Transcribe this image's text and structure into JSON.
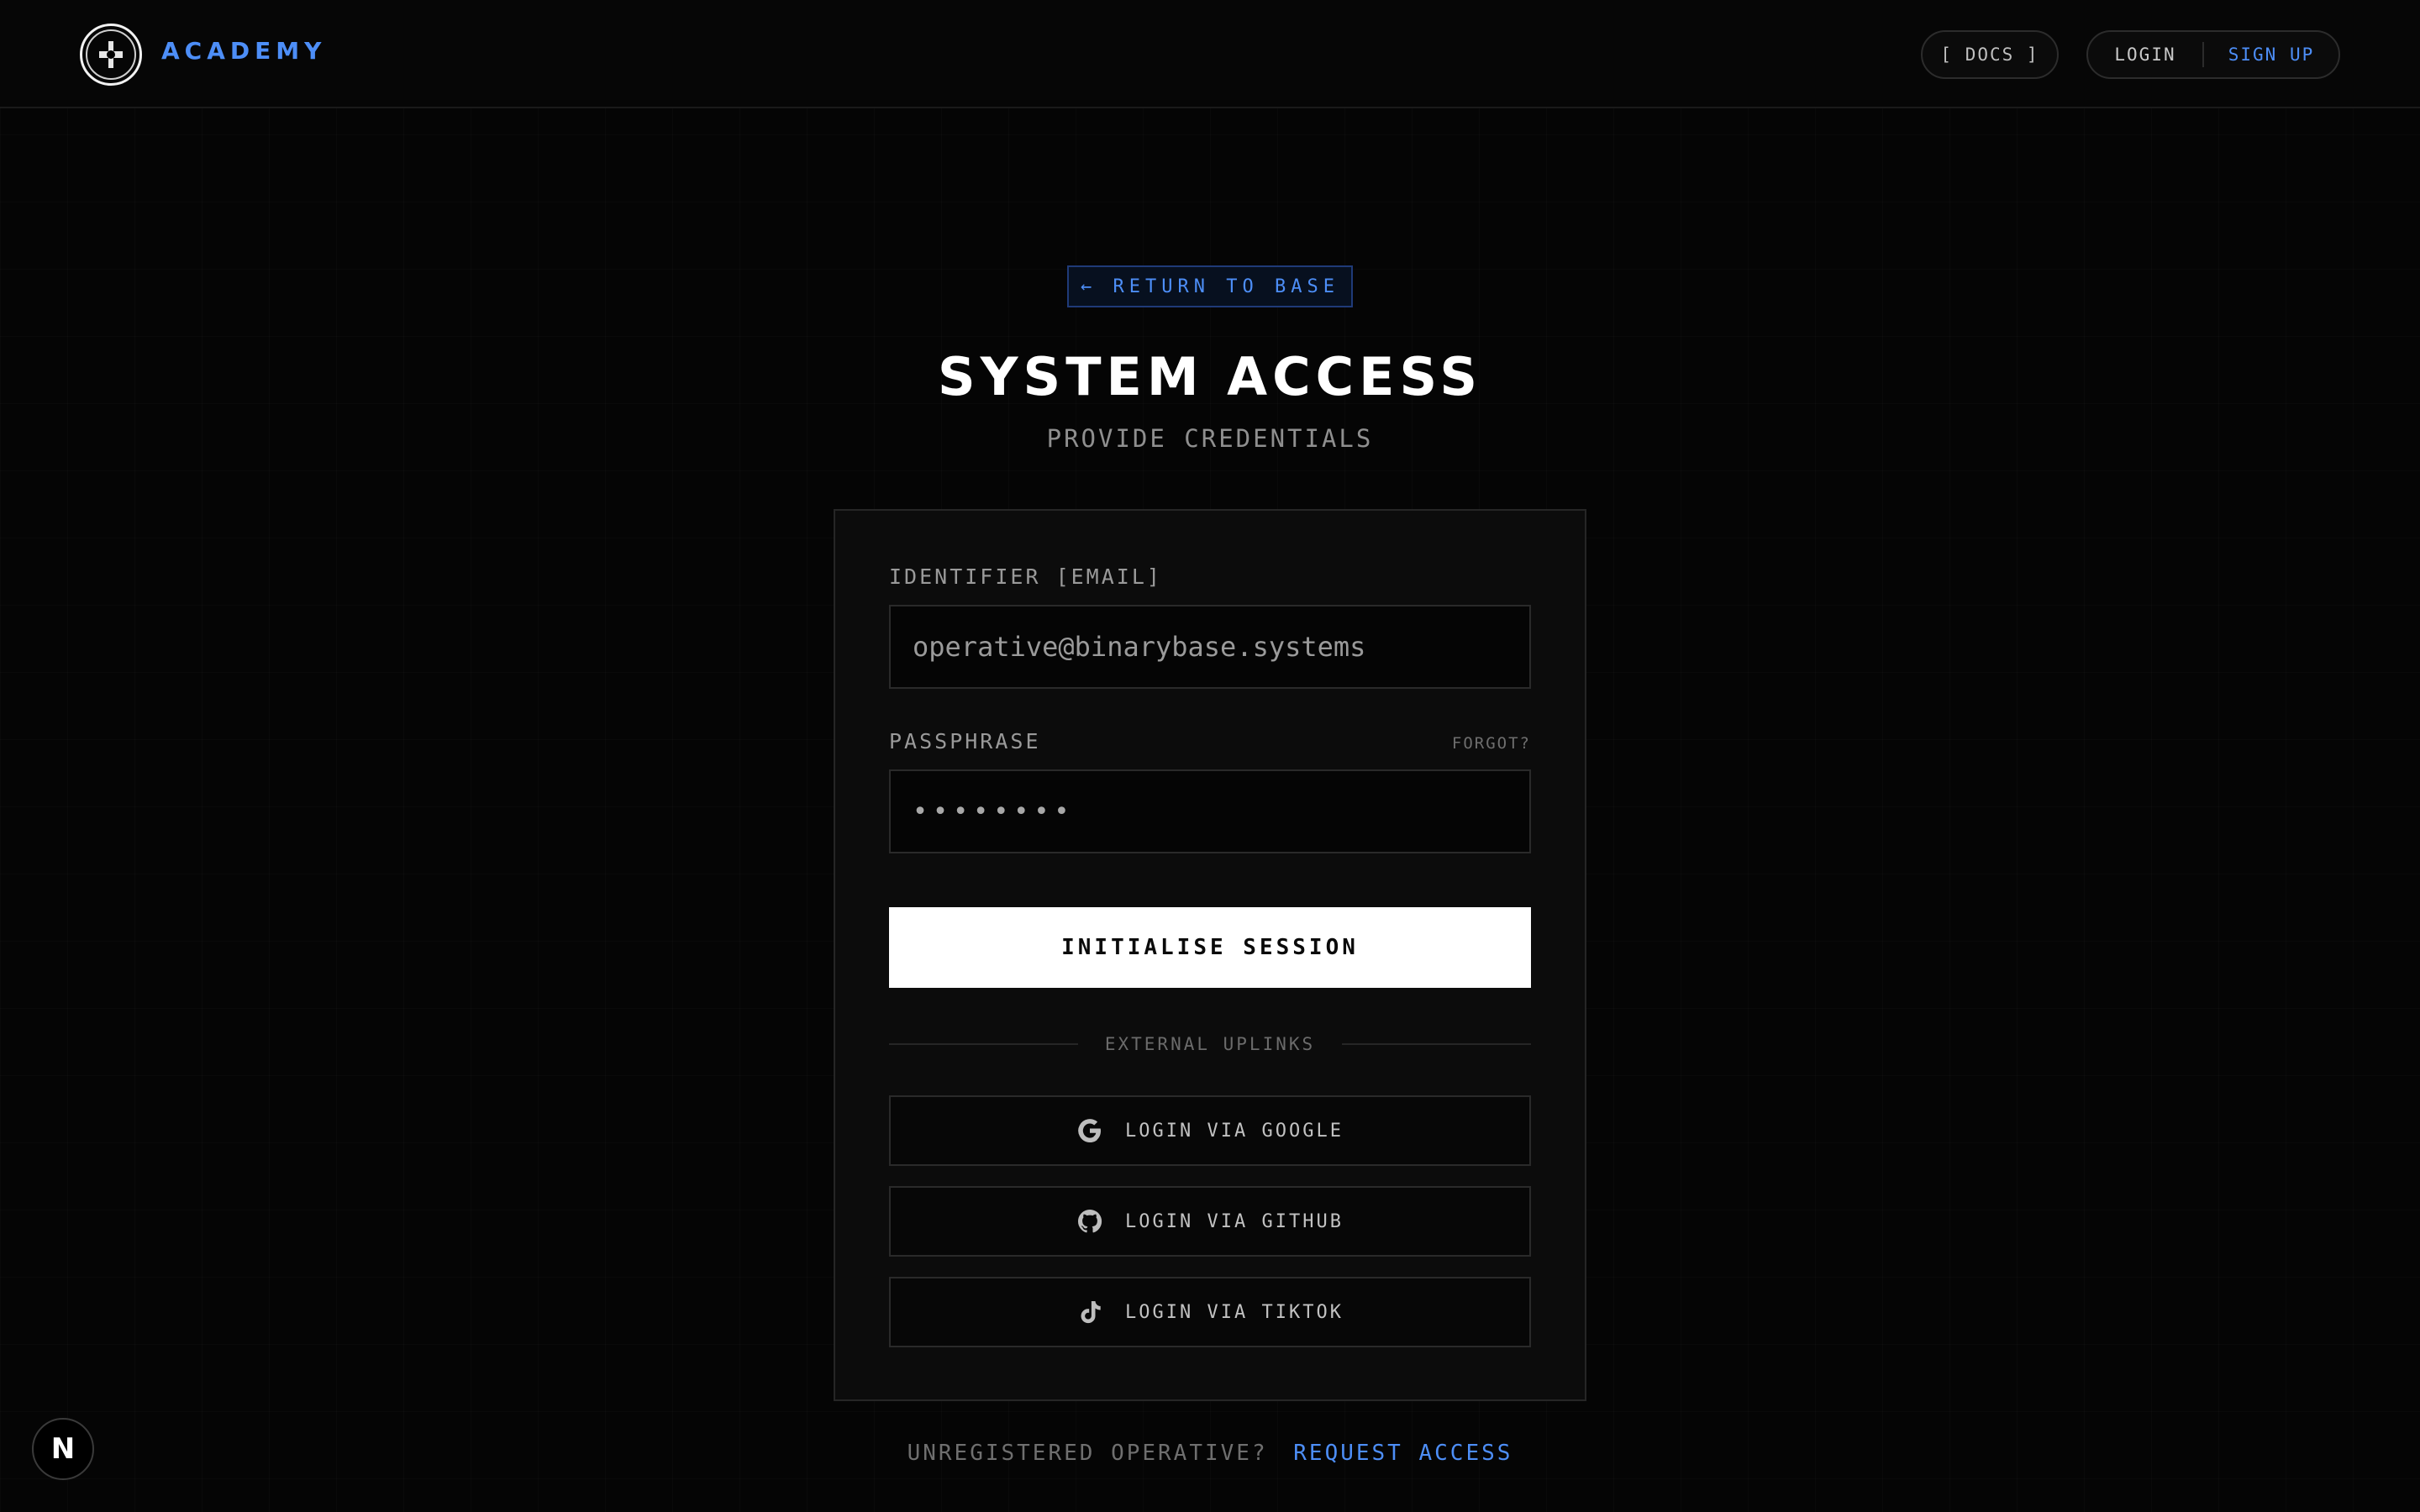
{
  "header": {
    "brand": "ACADEMY",
    "docs_label": "[ DOCS ]",
    "login_label": "LOGIN",
    "signup_label": "SIGN UP"
  },
  "hero": {
    "return_label": "← RETURN TO BASE",
    "title": "SYSTEM ACCESS",
    "subtitle": "PROVIDE CREDENTIALS"
  },
  "form": {
    "email_label": "IDENTIFIER [EMAIL]",
    "email_placeholder": "operative@binarybase.systems",
    "password_label": "PASSPHRASE",
    "forgot_label": "FORGOT?",
    "password_value": "••••••••",
    "submit_label": "INITIALISE SESSION",
    "divider_label": "EXTERNAL UPLINKS",
    "oauth": [
      {
        "label": "LOGIN VIA GOOGLE",
        "icon": "google-icon"
      },
      {
        "label": "LOGIN VIA GITHUB",
        "icon": "github-icon"
      },
      {
        "label": "LOGIN VIA TIKTOK",
        "icon": "tiktok-icon"
      }
    ]
  },
  "footer": {
    "question": "UNREGISTERED OPERATIVE?",
    "link": "REQUEST ACCESS"
  },
  "badge": {
    "letter": "N"
  },
  "colors": {
    "accent": "#4d8ef7",
    "background": "#050505",
    "card": "#0c0c0c"
  }
}
